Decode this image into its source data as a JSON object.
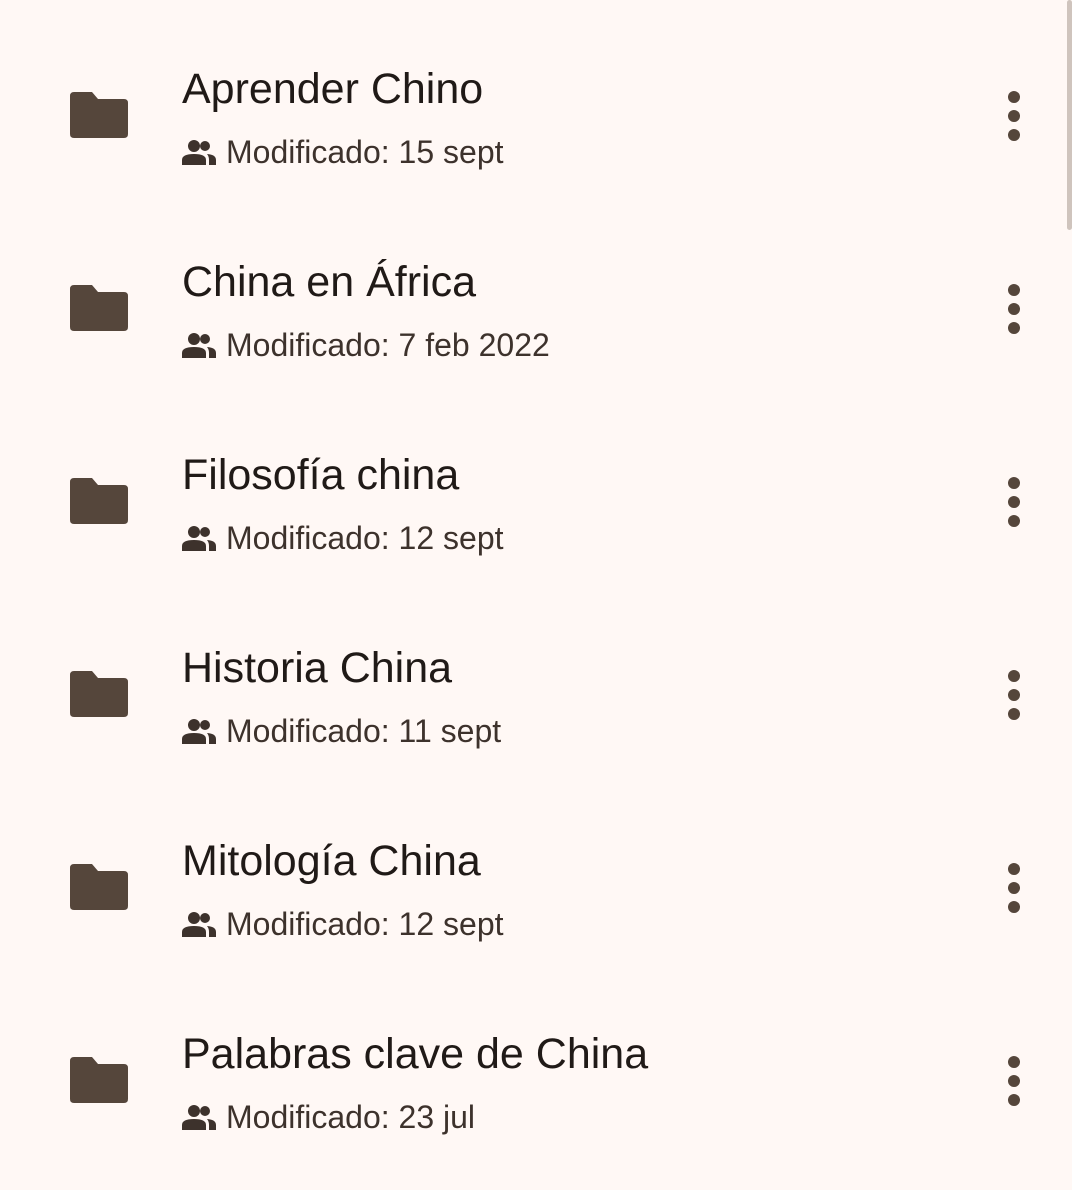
{
  "colors": {
    "background": "#fff8f5",
    "icon": "#55463b",
    "title": "#201a17",
    "meta": "#3d322c"
  },
  "folders": [
    {
      "title": "Aprender Chino",
      "meta": "Modificado: 15 sept",
      "icon": "folder-icon",
      "shared_icon": "people-icon"
    },
    {
      "title": "China en África",
      "meta": "Modificado: 7 feb 2022",
      "icon": "folder-icon",
      "shared_icon": "people-icon"
    },
    {
      "title": "Filosofía china",
      "meta": "Modificado: 12 sept",
      "icon": "folder-icon",
      "shared_icon": "people-icon"
    },
    {
      "title": "Historia China",
      "meta": "Modificado: 11 sept",
      "icon": "folder-icon",
      "shared_icon": "people-icon"
    },
    {
      "title": "Mitología China",
      "meta": "Modificado: 12 sept",
      "icon": "folder-icon",
      "shared_icon": "people-icon"
    },
    {
      "title": "Palabras clave de China",
      "meta": "Modificado: 23 jul",
      "icon": "folder-icon",
      "shared_icon": "people-icon"
    }
  ]
}
